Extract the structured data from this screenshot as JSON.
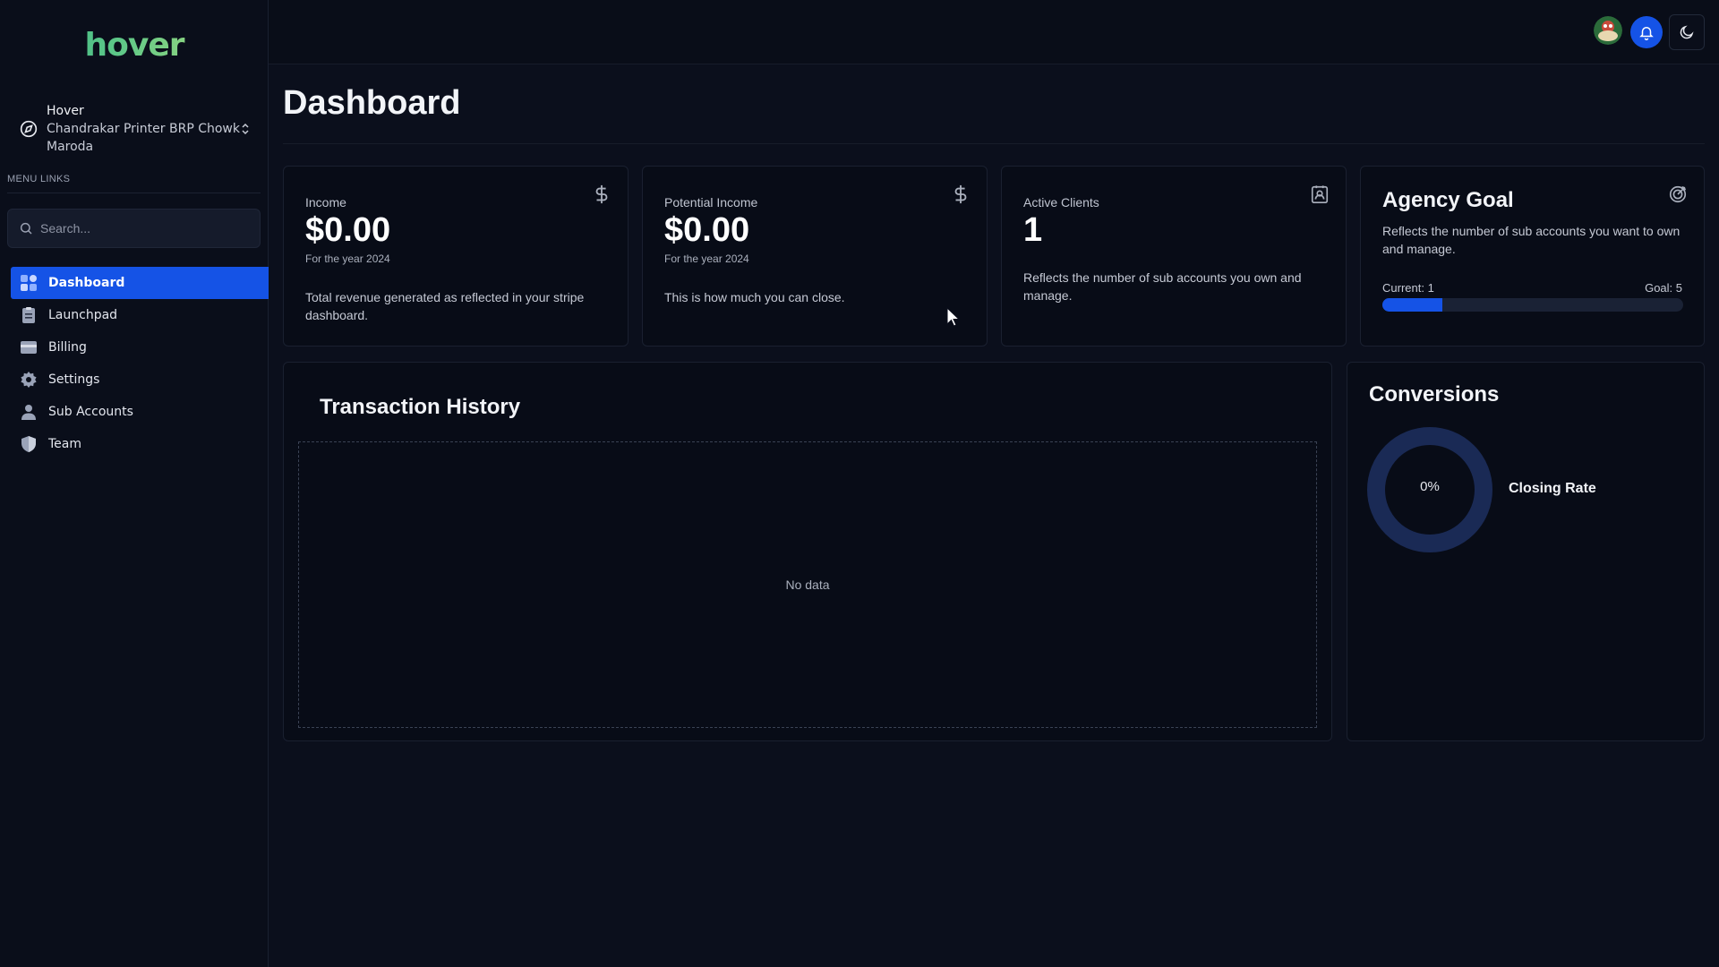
{
  "app": {
    "logo_text": "hover"
  },
  "account": {
    "name": "Hover",
    "address": "Chandrakar Printer BRP Chowk Maroda"
  },
  "sidebar": {
    "menu_label": "MENU LINKS",
    "search_placeholder": "Search...",
    "items": [
      {
        "label": "Dashboard",
        "icon": "dashboard-icon",
        "active": true
      },
      {
        "label": "Launchpad",
        "icon": "clipboard-icon",
        "active": false
      },
      {
        "label": "Billing",
        "icon": "credit-card-icon",
        "active": false
      },
      {
        "label": "Settings",
        "icon": "gear-icon",
        "active": false
      },
      {
        "label": "Sub Accounts",
        "icon": "person-icon",
        "active": false
      },
      {
        "label": "Team",
        "icon": "shield-icon",
        "active": false
      }
    ]
  },
  "header": {
    "title": "Dashboard"
  },
  "cards": {
    "income": {
      "label": "Income",
      "value": "$0.00",
      "sub": "For the year 2024",
      "description": "Total revenue generated as reflected in your stripe dashboard."
    },
    "potential": {
      "label": "Potential Income",
      "value": "$0.00",
      "sub": "For the year 2024",
      "description": "This is how much you can close."
    },
    "clients": {
      "label": "Active Clients",
      "value": "1",
      "description": "Reflects the number of sub accounts you own and manage."
    },
    "goal": {
      "title": "Agency Goal",
      "description": "Reflects the number of sub accounts you want to own and manage.",
      "current_label": "Current: 1",
      "goal_label": "Goal: 5",
      "progress_fraction": 0.2
    }
  },
  "transactions": {
    "title": "Transaction History",
    "empty_text": "No data"
  },
  "conversions": {
    "title": "Conversions",
    "rate_text": "0%",
    "rate_label": "Closing Rate",
    "rate_value": 0
  },
  "colors": {
    "accent": "#1553e6",
    "background": "#0b0f1c",
    "donut_track": "#1a2a55"
  }
}
